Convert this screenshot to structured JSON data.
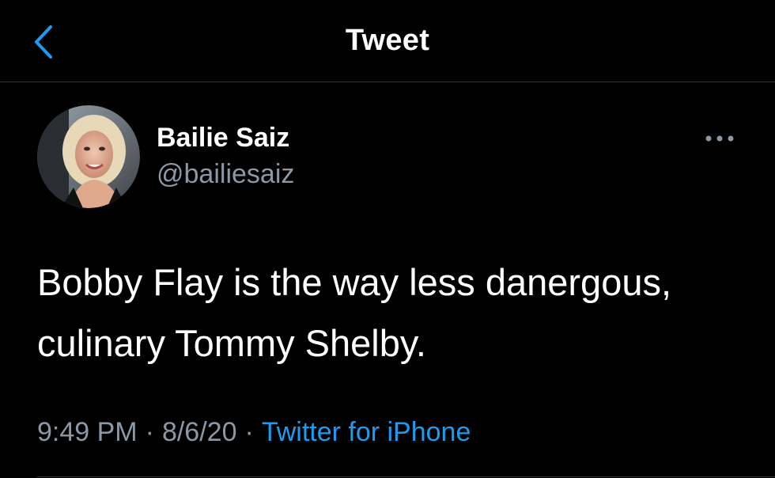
{
  "header": {
    "title": "Tweet",
    "back_icon": "chevron-left-icon",
    "accent_color": "#1d9bf0"
  },
  "author": {
    "name": "Bailie Saiz",
    "handle": "@bailiesaiz",
    "avatar_icon": "avatar"
  },
  "tweet": {
    "text": "Bobby Flay is the way less danergous,\nculinary Tommy Shelby."
  },
  "meta": {
    "time": "9:49 PM",
    "separator": "·",
    "date": "8/6/20",
    "source": "Twitter for iPhone"
  },
  "more_icon": "more-horizontal-icon",
  "colors": {
    "background": "#000000",
    "text_primary": "#ffffff",
    "text_secondary": "#8b98a5",
    "link": "#1d9bf0"
  }
}
